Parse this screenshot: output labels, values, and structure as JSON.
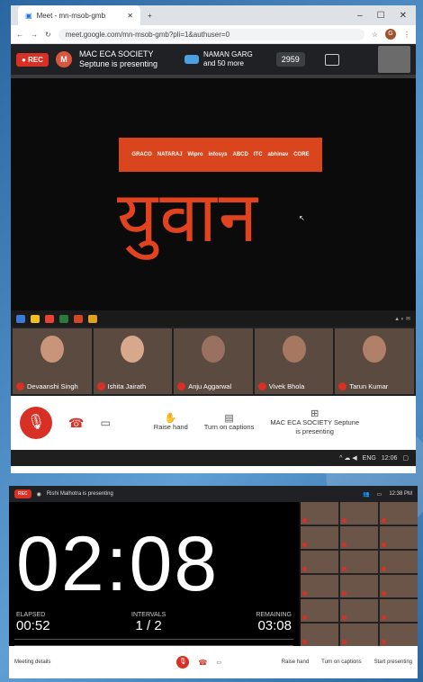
{
  "shot1": {
    "tab_title": "Meet - mn-msob-gmb",
    "tab_close": "✕",
    "new_tab": "+",
    "win_controls": [
      "–",
      "☐",
      "✕"
    ],
    "url": "meet.google.com/mn-msob-gmb?pli=1&authuser=0",
    "profile_initial": "G",
    "meeting": {
      "rec_label": "REC",
      "presenter_initial": "M",
      "presenter_title": "MAC ECA SOCIETY",
      "presenter_status": "Septune is presenting",
      "others_name": "NAMAN GARG",
      "others_more": "and 50 more",
      "time": "2959"
    },
    "slide": {
      "logos": [
        "GRACO",
        "NATARAJ",
        "Wipro",
        "infosys",
        "ABCD",
        "ITC",
        "abhinav",
        "CORE"
      ],
      "brand_text": "युवान"
    },
    "participants": [
      {
        "name": "Devaanshi Singh",
        "face": "#c9957a"
      },
      {
        "name": "Ishita Jairath",
        "face": "#d8a88c"
      },
      {
        "name": "Anju Aggarwal",
        "face": "#9a7060"
      },
      {
        "name": "Vivek Bhola",
        "face": "#a67862"
      },
      {
        "name": "Tarun Kumar",
        "face": "#b08068"
      }
    ],
    "controls": {
      "raise_hand": "Raise hand",
      "captions": "Turn on captions",
      "presenting_title": "MAC ECA SOCIETY Septune",
      "presenting_sub": "is presenting"
    },
    "system_tray": {
      "lang": "ENG",
      "clock": "12:06"
    }
  },
  "shot2": {
    "rec_label": "REC",
    "presenting": "Rishi Malhotra is presenting",
    "time": "12:38 PM",
    "timer": "02:08",
    "elapsed_label": "ELAPSED",
    "elapsed": "00:52",
    "intervals_label": "INTERVALS",
    "intervals": "1 / 2",
    "remaining_label": "REMAINING",
    "remaining": "03:08",
    "meeting_details": "Meeting details",
    "controls": [
      "Raise hand",
      "Turn on captions",
      "Start presenting"
    ]
  }
}
